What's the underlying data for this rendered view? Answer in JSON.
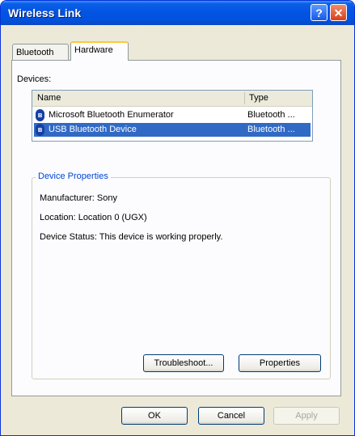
{
  "window": {
    "title": "Wireless Link",
    "help_glyph": "?",
    "close_glyph": "✕"
  },
  "tabs": [
    {
      "label": "Bluetooth"
    },
    {
      "label": "Hardware"
    }
  ],
  "devices": {
    "label": "Devices:",
    "columns": [
      "Name",
      "Type"
    ],
    "rows": [
      {
        "name": "Microsoft Bluetooth Enumerator",
        "type": "Bluetooth ...",
        "icon": "bluetooth-icon"
      },
      {
        "name": "USB Bluetooth Device",
        "type": "Bluetooth ...",
        "icon": "bluetooth-icon",
        "selected": true
      }
    ]
  },
  "properties": {
    "legend": "Device Properties",
    "manufacturer": "Manufacturer: Sony",
    "location": "Location: Location 0 (UGX)",
    "status": "Device Status: This device is working properly."
  },
  "buttons": {
    "troubleshoot": "Troubleshoot...",
    "properties": "Properties",
    "ok": "OK",
    "cancel": "Cancel",
    "apply": "Apply"
  }
}
